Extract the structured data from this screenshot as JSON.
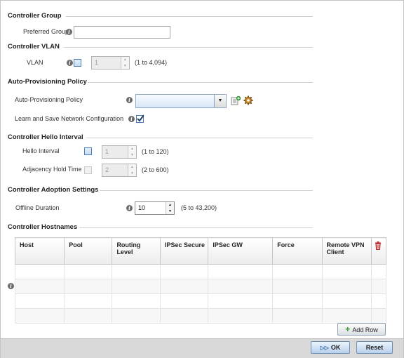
{
  "controller_group": {
    "heading": "Controller Group",
    "preferred_group_label": "Preferred Group",
    "preferred_group_value": ""
  },
  "controller_vlan": {
    "heading": "Controller VLAN",
    "vlan_label": "VLAN",
    "vlan_value": "1",
    "vlan_range": "(1 to 4,094)"
  },
  "auto_provisioning": {
    "heading": "Auto-Provisioning Policy",
    "policy_label": "Auto-Provisioning Policy",
    "policy_value": "",
    "learn_label": "Learn and Save Network Configuration",
    "learn_checked": true
  },
  "hello_interval": {
    "heading": "Controller Hello Interval",
    "hello_label": "Hello Interval",
    "hello_value": "1",
    "hello_range": "(1 to 120)",
    "adjacency_label": "Adjacency Hold Time",
    "adjacency_value": "2",
    "adjacency_range": "(2 to 600)"
  },
  "adoption_settings": {
    "heading": "Controller Adoption Settings",
    "offline_label": "Offline Duration",
    "offline_value": "10",
    "offline_range": "(5 to 43,200)"
  },
  "hostnames": {
    "heading": "Controller Hostnames",
    "columns": [
      "Host",
      "Pool",
      "Routing Level",
      "IPSec Secure",
      "IPSec GW",
      "Force",
      "Remote VPN Client"
    ],
    "add_row_label": "Add Row"
  },
  "footer": {
    "ok_label": "OK",
    "reset_label": "Reset"
  },
  "icons": {
    "info": "info-icon",
    "add_policy": "add-document-icon",
    "policy_settings": "gear-icon",
    "delete": "trash-icon",
    "add_row": "plus-icon",
    "ok": "forward-icon"
  },
  "colors": {
    "accent_blue": "#4a7fb8",
    "add_green": "#2f9a2f",
    "delete_red": "#c0282d"
  }
}
